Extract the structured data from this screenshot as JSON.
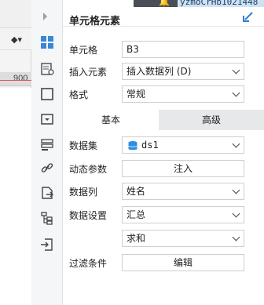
{
  "editor": {
    "ruler_label": "900"
  },
  "topbar": {
    "user_label": "yzmoCrHb1021448",
    "bell_icon": "bell-icon"
  },
  "header": {
    "title": "单元格元素",
    "pin_icon": "pin-icon"
  },
  "rail": {
    "items": [
      {
        "icon": "cell-element-icon",
        "active": true
      },
      {
        "icon": "cell-attribute-icon"
      },
      {
        "icon": "border-frame-icon"
      },
      {
        "icon": "widget-icon"
      },
      {
        "icon": "condition-icon"
      },
      {
        "icon": "hyperlink-icon"
      },
      {
        "icon": "export-icon"
      },
      {
        "icon": "tree-icon"
      },
      {
        "icon": "import-icon"
      }
    ]
  },
  "cell": {
    "label": "单元格",
    "value": "B3"
  },
  "insert": {
    "label": "插入元素",
    "value": "插入数据列 (D)"
  },
  "format": {
    "label": "格式",
    "value": "常规"
  },
  "tabs": {
    "basic": "基本",
    "advanced": "高级"
  },
  "dataset": {
    "label": "数据集",
    "value": "ds1"
  },
  "dynamic_param": {
    "label": "动态参数",
    "button": "注入"
  },
  "data_column": {
    "label": "数据列",
    "value": "姓名"
  },
  "data_setting": {
    "label": "数据设置",
    "value": "汇总"
  },
  "aggregate": {
    "value": "求和"
  },
  "filter": {
    "label": "过滤条件",
    "button": "编辑"
  },
  "colors": {
    "accent": "#2f7fd6",
    "active_icon": "#3a86d8",
    "tab_inactive": "#e7e8ea"
  }
}
